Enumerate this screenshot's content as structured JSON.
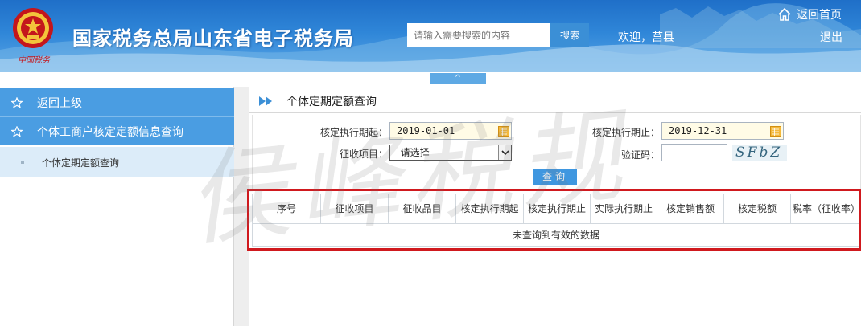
{
  "header": {
    "seal_text": "中国税务",
    "site_title": "国家税务总局山东省电子税务局",
    "search_placeholder": "请输入需要搜索的内容",
    "search_button": "搜索",
    "welcome": "欢迎，莒县",
    "home_link": "返回首页",
    "logout": "退出",
    "collapse_glyph": "^"
  },
  "sidebar": {
    "items": [
      {
        "label": "返回上级"
      },
      {
        "label": "个体工商户核定定额信息查询"
      }
    ],
    "sub_item": "个体定期定额查询"
  },
  "page": {
    "title": "个体定期定额查询"
  },
  "form": {
    "start_label": "核定执行期起：",
    "start_value": "2019-01-01",
    "end_label": "核定执行期止：",
    "end_value": "2019-12-31",
    "item_label": "征收项目：",
    "item_selected": "--请选择--",
    "captcha_label": "验证码：",
    "captcha_value": "",
    "captcha_image_text": "SFbZ",
    "query_button": "查询"
  },
  "table": {
    "columns": [
      "序号",
      "征收项目",
      "征收品目",
      "核定执行期起",
      "核定执行期止",
      "实际执行期止",
      "核定销售额",
      "核定税额",
      "税率（征收率）"
    ],
    "empty_message": "未查询到有效的数据"
  },
  "watermark": "侯峰税规",
  "colors": {
    "header_blue": "#2f86d8",
    "sidebar_blue": "#4a9de2",
    "highlight_red": "#d0191e",
    "button_blue": "#3f97e0"
  }
}
